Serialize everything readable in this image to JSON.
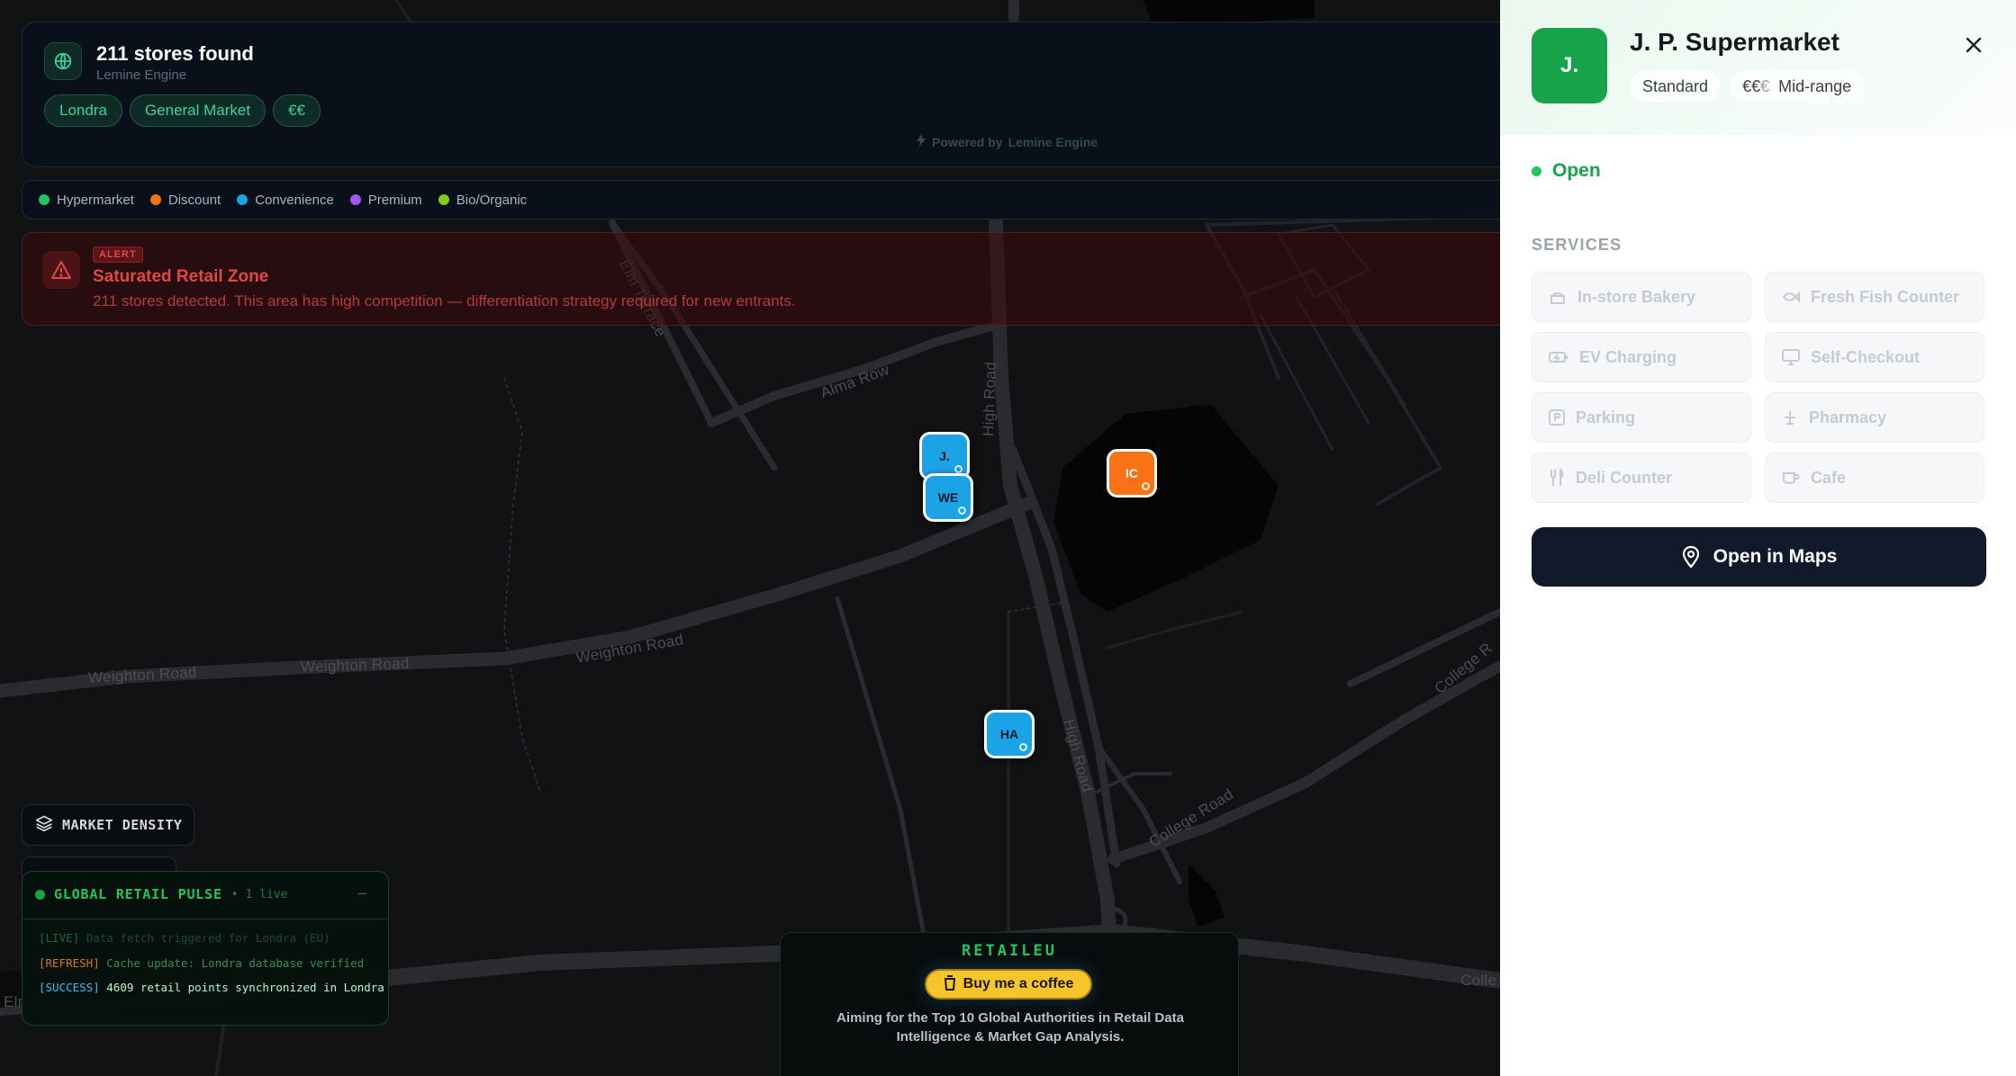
{
  "header": {
    "title": "211 stores found",
    "subtitle": "Lemine Engine",
    "chips": [
      "Londra",
      "General Market",
      "€€"
    ],
    "powered_prefix": "Powered by",
    "powered_engine": "Lemine Engine"
  },
  "legend": [
    {
      "label": "Hypermarket",
      "color": "#22c55e"
    },
    {
      "label": "Discount",
      "color": "#f97316"
    },
    {
      "label": "Convenience",
      "color": "#1ba3e6"
    },
    {
      "label": "Premium",
      "color": "#a855f7"
    },
    {
      "label": "Bio/Organic",
      "color": "#84cc16"
    }
  ],
  "alert": {
    "badge": "ALERT",
    "title": "Saturated Retail Zone",
    "text": "211 stores detected. This area has high competition — differentiation strategy required for new entrants."
  },
  "map": {
    "road_labels": [
      "Elm Terrace",
      "Alma Row",
      "High Road",
      "Weighton Road",
      "Weighton Road",
      "Weighton Road",
      "High Road",
      "College Road",
      "College R",
      "Colle",
      "Elm"
    ],
    "markers": [
      {
        "label": "J.",
        "type": "Convenience"
      },
      {
        "label": "WE",
        "type": "Convenience"
      },
      {
        "label": "IC",
        "type": "Discount"
      },
      {
        "label": "HA",
        "type": "Convenience"
      }
    ]
  },
  "density": {
    "label": "MARKET DENSITY"
  },
  "pulse": {
    "title": "GLOBAL RETAIL PULSE",
    "live": "• 1 live",
    "minimize": "—",
    "logs": [
      {
        "tag": "[LIVE]",
        "msg": "Data fetch triggered for Londra (EU)"
      },
      {
        "tag": "[REFRESH]",
        "msg": "Cache update: Londra database verified"
      },
      {
        "tag": "[SUCCESS]",
        "msg": "4609 retail points synchronized in Londra"
      }
    ]
  },
  "retail": {
    "title": "RETAILEU",
    "coffee": "Buy me a coffee",
    "text": "Aiming for the Top 10 Global Authorities in Retail Data Intelligence & Market Gap Analysis."
  },
  "panel": {
    "avatar": "J.",
    "name": "J. P. Supermarket",
    "tag_standard": "Standard",
    "price_active": "€€",
    "price_dim": "€",
    "price_label": "Mid-range",
    "status": "Open",
    "services_label": "SERVICES",
    "services": [
      {
        "label": "In-store Bakery",
        "icon": "bakery-icon"
      },
      {
        "label": "Fresh Fish Counter",
        "icon": "fish-icon"
      },
      {
        "label": "EV Charging",
        "icon": "battery-icon"
      },
      {
        "label": "Self-Checkout",
        "icon": "monitor-icon"
      },
      {
        "label": "Parking",
        "icon": "parking-icon"
      },
      {
        "label": "Pharmacy",
        "icon": "pharmacy-icon"
      },
      {
        "label": "Deli Counter",
        "icon": "utensils-icon"
      },
      {
        "label": "Cafe",
        "icon": "coffee-icon"
      }
    ],
    "maps_button": "Open in Maps",
    "close": "✕"
  }
}
